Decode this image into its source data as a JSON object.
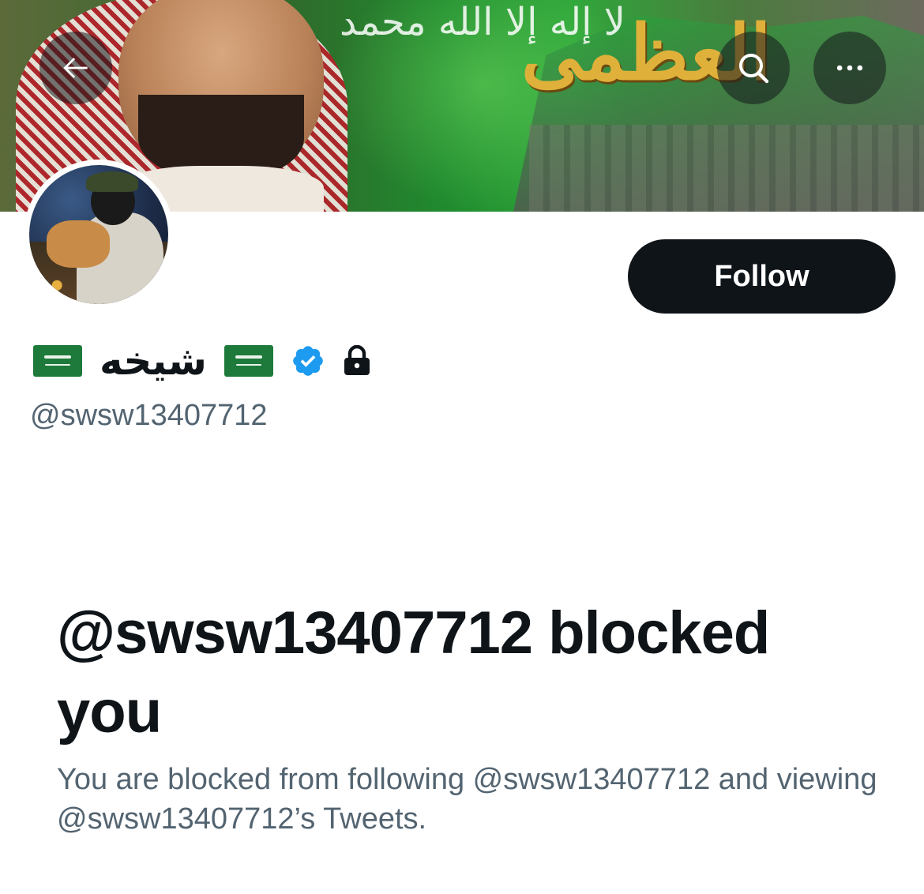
{
  "header": {
    "back_icon": "arrow-left-icon",
    "search_icon": "search-icon",
    "more_icon": "more-horizontal-icon"
  },
  "banner": {
    "script_top": "لا إله إلا الله محمد",
    "script_gold": "العظمى"
  },
  "profile": {
    "display_name": "شيخه",
    "handle": "@swsw13407712",
    "verified": true,
    "protected": true,
    "flag_icon": "saudi-flag-icon",
    "follow_label": "Follow"
  },
  "blocked": {
    "title": "@swsw13407712 blocked you",
    "description": "You are blocked from following @swsw13407712 and viewing @swsw13407712’s Tweets."
  },
  "colors": {
    "text_primary": "#0f1419",
    "text_secondary": "#536471",
    "verified_blue": "#1d9bf0",
    "button_bg": "#0f1419"
  }
}
